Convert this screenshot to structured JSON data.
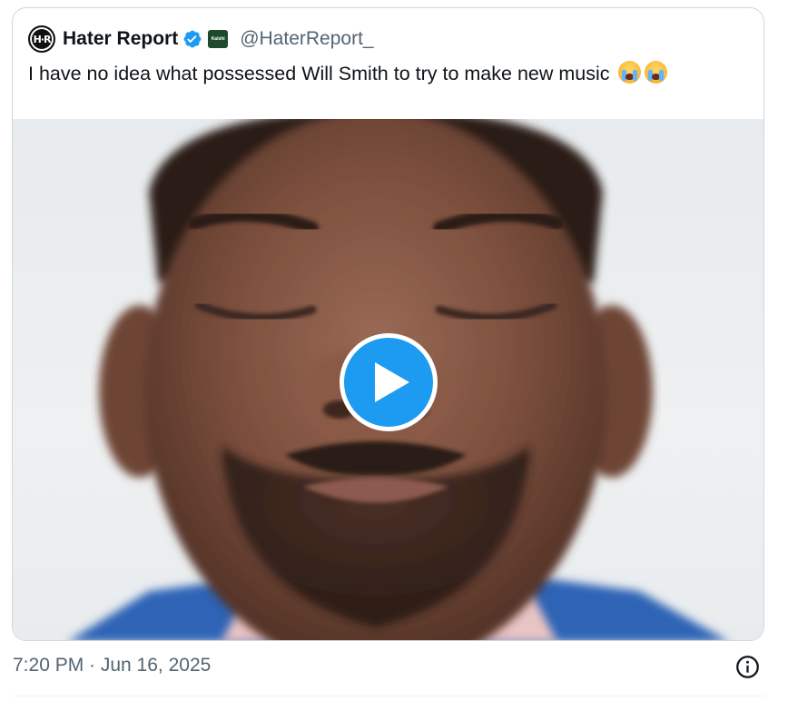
{
  "tweet": {
    "avatar_text": "H·R",
    "display_name": "Hater Report",
    "affiliate_badge_text": "Kalshi",
    "handle": "@HaterReport_",
    "text": "I have no idea what possessed Will Smith to try to make new music",
    "emojis": [
      "loudly-crying-face",
      "loudly-crying-face"
    ],
    "timestamp": "7:20 PM · Jun 16, 2025"
  },
  "icons": {
    "verified": "verified-badge-icon",
    "play": "play-icon",
    "info": "info-icon"
  },
  "colors": {
    "verified_blue": "#1d9bf0",
    "play_blue": "#1d9bf0",
    "affiliate_green": "#1d4a2b",
    "secondary_text": "#536471"
  }
}
